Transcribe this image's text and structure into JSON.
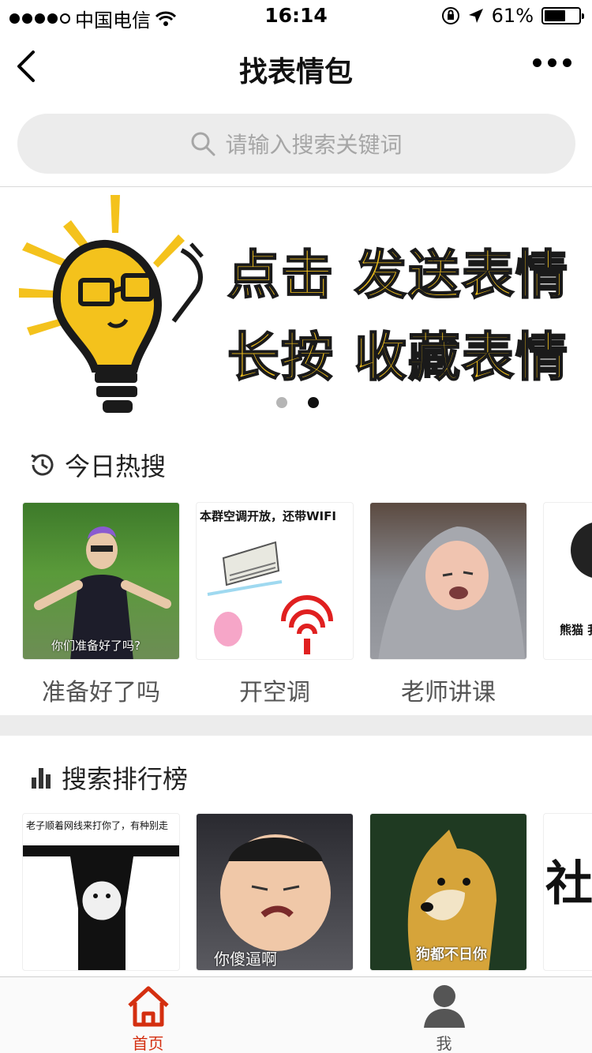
{
  "status_bar": {
    "carrier": "中国电信",
    "time": "16:14",
    "battery": "61%",
    "battery_level": 0.61
  },
  "nav": {
    "title": "找表情包"
  },
  "search": {
    "placeholder": "请输入搜索关键词"
  },
  "banner": {
    "line1": "点击 发送表情",
    "line2": "长按 收藏表情",
    "slide_count": 2,
    "active_slide": 2
  },
  "hot_today": {
    "title": "今日热搜",
    "items": [
      {
        "caption": "准备好了吗",
        "image_text": "你们准备好了吗?"
      },
      {
        "caption": "开空调",
        "image_text": "本群空调开放，还带WIFI"
      },
      {
        "caption": "老师讲课",
        "image_text": ""
      },
      {
        "caption": "",
        "image_text": "熊猫 我是帅"
      }
    ]
  },
  "ranking": {
    "title": "搜索排行榜",
    "items": [
      {
        "image_text": "老子顺着网线来打你了，有种别走"
      },
      {
        "image_text": "你傻逼啊"
      },
      {
        "image_text": "狗都不日你"
      },
      {
        "image_text": "社会"
      }
    ]
  },
  "tabbar": {
    "home": "首页",
    "me": "我"
  },
  "colors": {
    "accent": "#d42f10",
    "banner_yellow": "#f4c21c",
    "gray_band": "#ececec"
  }
}
